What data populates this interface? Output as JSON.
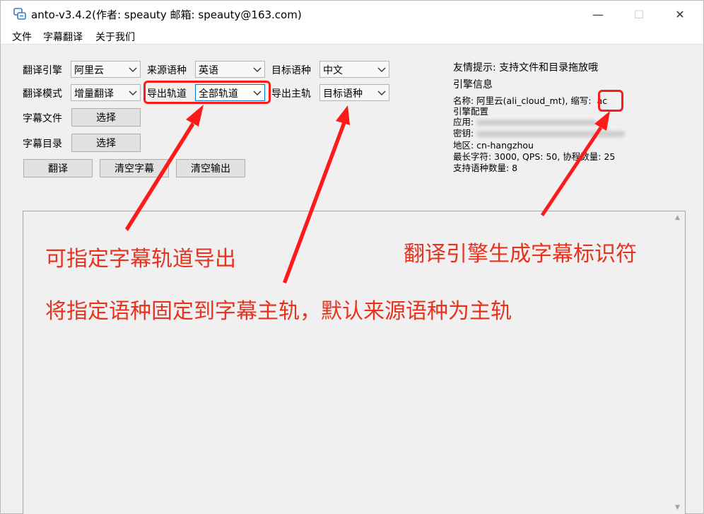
{
  "window": {
    "title": "anto-v3.4.2(作者: speauty 邮箱: speauty@163.com)",
    "min_glyph": "—",
    "max_glyph": "☐",
    "close_glyph": "✕"
  },
  "menu": [
    "文件",
    "字幕翻译",
    "关于我们"
  ],
  "form": {
    "engine_label": "翻译引擎",
    "engine_value": "阿里云",
    "source_lang_label": "来源语种",
    "source_lang_value": "英语",
    "target_lang_label": "目标语种",
    "target_lang_value": "中文",
    "mode_label": "翻译模式",
    "mode_value": "增量翻译",
    "export_track_label": "导出轨道",
    "export_track_value": "全部轨道",
    "export_main_label": "导出主轨",
    "export_main_value": "目标语种",
    "subtitle_file_label": "字幕文件",
    "subtitle_file_button": "选择",
    "subtitle_dir_label": "字幕目录",
    "subtitle_dir_button": "选择",
    "translate_button": "翻译",
    "clear_subtitle_button": "清空字幕",
    "clear_output_button": "清空输出"
  },
  "info": {
    "tip": "友情提示: 支持文件和目录拖放哦",
    "engine_info_title": "引擎信息",
    "name_line": "名称: 阿里云(ali_cloud_mt), 缩写:",
    "abbr": "ac",
    "config_title": "引擎配置",
    "app_label": "应用:",
    "key_label": "密钥:",
    "region_line": "地区: cn-hangzhou",
    "limits_line": "最长字符: 3000, QPS: 50, 协程数量: 25",
    "lang_count_line": "支持语种数量: 8"
  },
  "annotations": {
    "track_note": "可指定字幕轨道导出",
    "main_track_note": "将指定语种固定到字幕主轨，默认来源语种为主轨",
    "abbr_note": "翻译引擎生成字幕标识符"
  },
  "colors": {
    "annotation_red": "#e8321e",
    "box_red": "#ff1a1a",
    "window_bg": "#f0f0f0"
  },
  "icons": [
    "app-icon",
    "minimize-icon",
    "maximize-icon",
    "close-icon",
    "chevron-down-icon"
  ]
}
